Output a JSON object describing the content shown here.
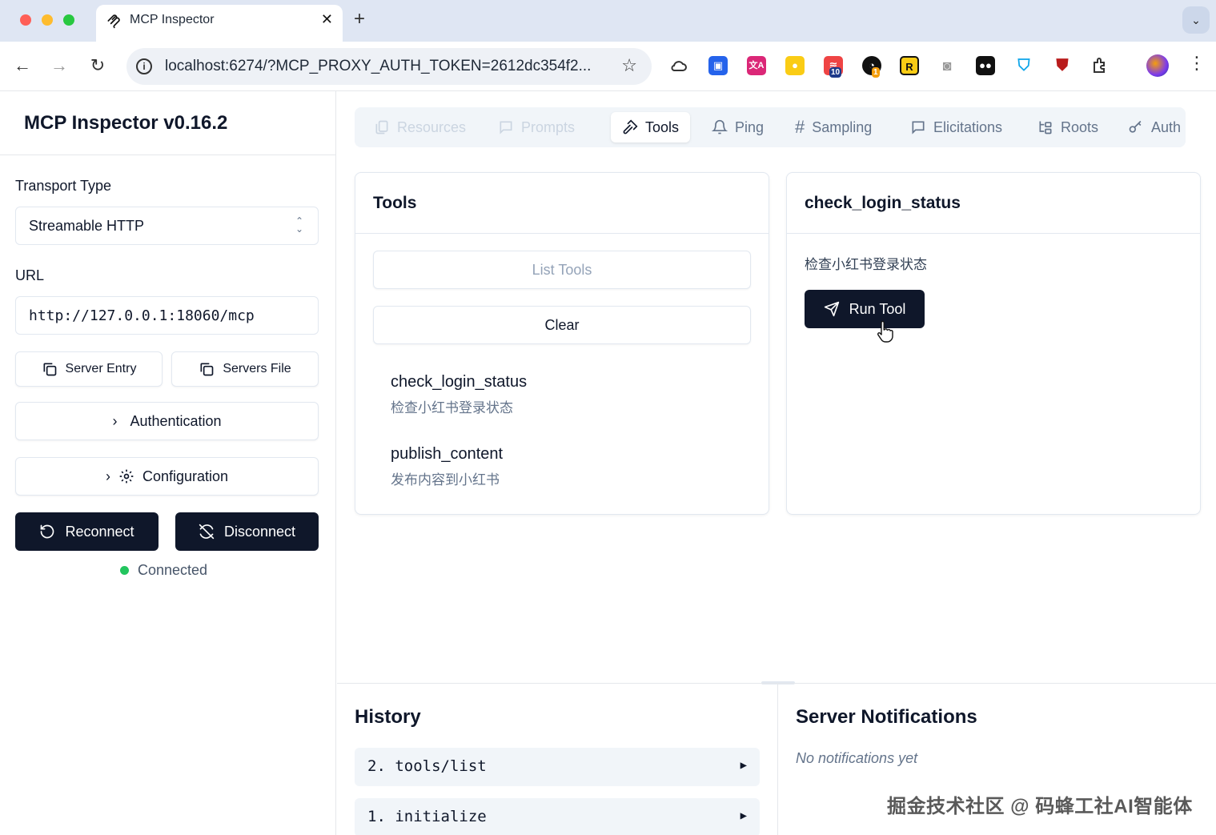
{
  "browser": {
    "tab_title": "MCP Inspector",
    "tab_close": "✕",
    "new_tab": "+",
    "url": "localhost:6274/?MCP_PROXY_AUTH_TOKEN=2612dc354f2...",
    "extension_badges": {
      "red_ext": "10",
      "spinner_ext": "1",
      "r_ext": "R"
    }
  },
  "sidebar": {
    "title": "MCP Inspector v0.16.2",
    "transport_label": "Transport Type",
    "transport_value": "Streamable HTTP",
    "url_label": "URL",
    "url_value": "http://127.0.0.1:18060/mcp",
    "server_entry_label": "Server Entry",
    "servers_file_label": "Servers File",
    "authentication_label": "Authentication",
    "configuration_label": "Configuration",
    "reconnect_label": "Reconnect",
    "disconnect_label": "Disconnect",
    "status_text": "Connected",
    "status_color": "#22c55e"
  },
  "tabs": [
    {
      "label": "Resources"
    },
    {
      "label": "Prompts"
    },
    {
      "label": "Tools"
    },
    {
      "label": "Ping"
    },
    {
      "label": "Sampling"
    },
    {
      "label": "Elicitations"
    },
    {
      "label": "Roots"
    },
    {
      "label": "Auth"
    }
  ],
  "tools_panel": {
    "title": "Tools",
    "list_tools_label": "List Tools",
    "clear_label": "Clear",
    "items": [
      {
        "name": "check_login_status",
        "description": "检查小红书登录状态"
      },
      {
        "name": "publish_content",
        "description": "发布内容到小红书"
      }
    ]
  },
  "detail_panel": {
    "title": "check_login_status",
    "description": "检查小红书登录状态",
    "run_label": "Run Tool"
  },
  "history": {
    "title": "History",
    "rows": [
      {
        "text": "2. tools/list",
        "arrow": "▶"
      },
      {
        "text": "1. initialize",
        "arrow": "▶"
      }
    ]
  },
  "notifications": {
    "title": "Server Notifications",
    "empty_text": "No notifications yet"
  },
  "watermark": "掘金技术社区 @ 码蜂工社AI智能体"
}
